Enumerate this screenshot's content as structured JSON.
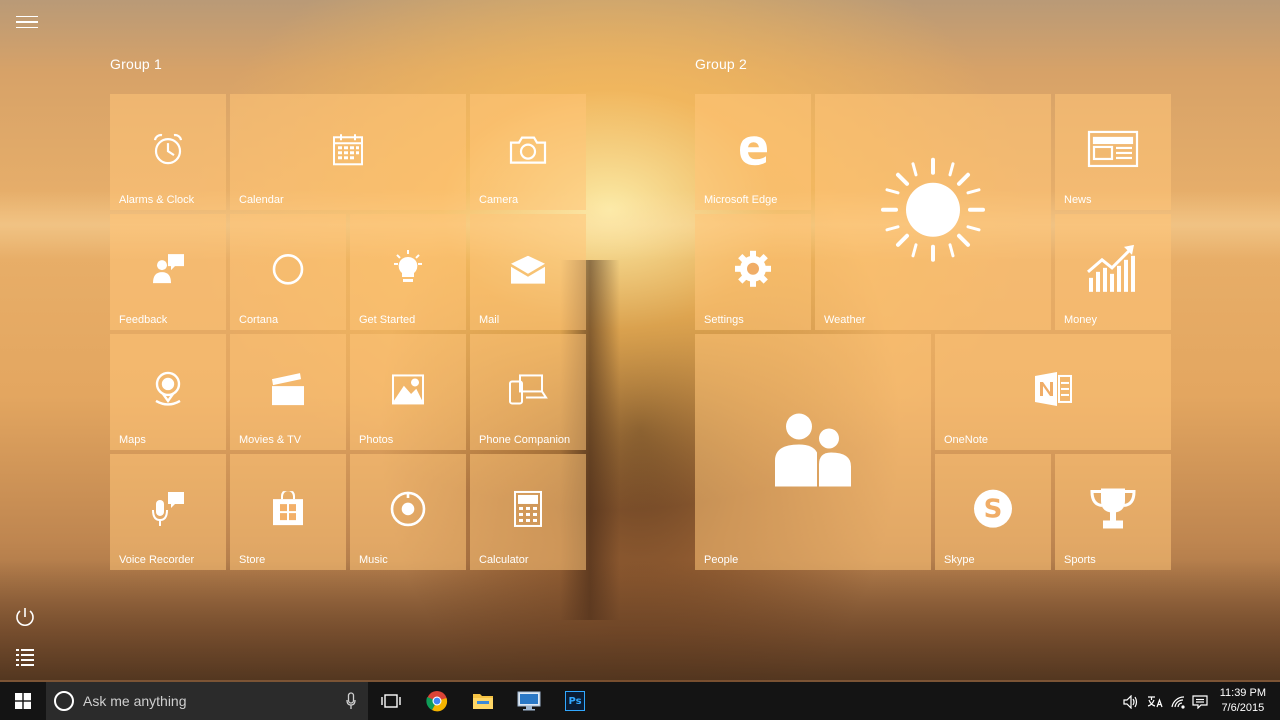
{
  "start": {
    "groups": [
      {
        "title": "Group 1"
      },
      {
        "title": "Group 2"
      }
    ],
    "tiles": {
      "alarms": "Alarms & Clock",
      "calendar": "Calendar",
      "camera": "Camera",
      "feedback": "Feedback",
      "cortana": "Cortana",
      "get_started": "Get Started",
      "mail": "Mail",
      "maps": "Maps",
      "movies": "Movies & TV",
      "photos": "Photos",
      "phone": "Phone Companion",
      "voice": "Voice Recorder",
      "store": "Store",
      "music": "Music",
      "calculator": "Calculator",
      "edge": "Microsoft Edge",
      "weather": "Weather",
      "news": "News",
      "settings": "Settings",
      "money": "Money",
      "people": "People",
      "onenote": "OneNote",
      "skype": "Skype",
      "sports": "Sports"
    },
    "tile_color": "#ffc478"
  },
  "taskbar": {
    "search_placeholder": "Ask me anything",
    "pinned_apps": [
      "task-view",
      "chrome",
      "file-explorer",
      "remote-desktop",
      "photoshop"
    ],
    "photoshop_label": "Ps",
    "clock_time": "11:39 PM",
    "clock_date": "7/6/2015",
    "background_color": "#141414"
  }
}
